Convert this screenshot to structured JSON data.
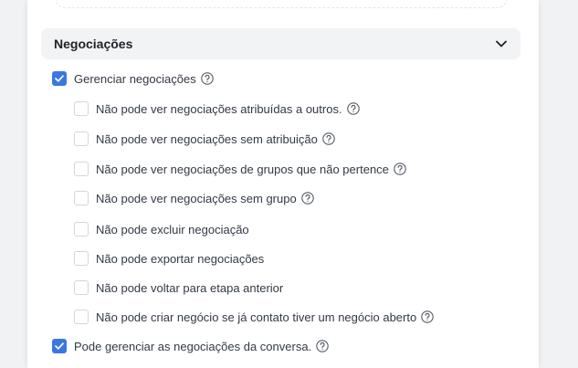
{
  "section": {
    "title": "Negociações",
    "expanded": true
  },
  "permissions": [
    {
      "label": "Gerenciar negociações",
      "checked": true,
      "help": true,
      "level": 0
    },
    {
      "label": "Não pode ver negociações atribuídas a outros.",
      "checked": false,
      "help": true,
      "level": 1
    },
    {
      "label": "Não pode ver negociações sem atribuição",
      "checked": false,
      "help": true,
      "level": 1
    },
    {
      "label": "Não pode ver negociações de grupos que não pertence",
      "checked": false,
      "help": true,
      "level": 1
    },
    {
      "label": "Não pode ver negociações sem grupo",
      "checked": false,
      "help": true,
      "level": 1
    },
    {
      "label": "Não pode excluir negociação",
      "checked": false,
      "help": false,
      "level": 1
    },
    {
      "label": "Não pode exportar negociações",
      "checked": false,
      "help": false,
      "level": 1
    },
    {
      "label": "Não pode voltar para etapa anterior",
      "checked": false,
      "help": false,
      "level": 1
    },
    {
      "label": "Não pode criar negócio se já contato tiver um negócio aberto",
      "checked": false,
      "help": true,
      "level": 1
    },
    {
      "label": "Pode gerenciar as negociações da conversa.",
      "checked": true,
      "help": true,
      "level": 0
    }
  ],
  "colors": {
    "checkbox_checked": "#3a78e0",
    "checkbox_border": "#d3d6dc",
    "header_bg": "#f2f3f5"
  }
}
